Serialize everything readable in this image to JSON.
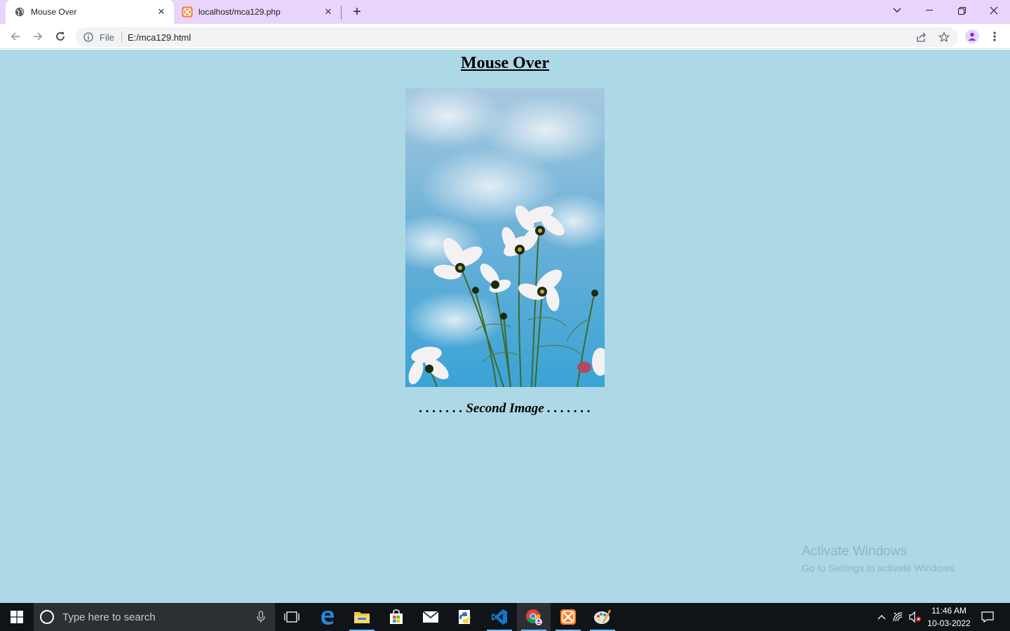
{
  "browser": {
    "tabs": [
      {
        "title": "Mouse Over",
        "active": true,
        "icon": "globe-icon"
      },
      {
        "title": "localhost/mca129.php",
        "active": false,
        "icon": "xampp-icon"
      }
    ],
    "address": {
      "scheme_label": "File",
      "url": "E:/mca129.html"
    }
  },
  "page": {
    "heading": "Mouse Over",
    "caption": ". . . . . . . Second Image . . . . . . .",
    "image": {
      "subject": "white cosmos flowers against blue sky"
    }
  },
  "watermark": {
    "line1": "Activate Windows",
    "line2": "Go to Settings to activate Windows."
  },
  "taskbar": {
    "search_placeholder": "Type here to search",
    "apps": [
      "task-view-icon",
      "edge-icon",
      "file-explorer-icon",
      "store-icon",
      "mail-icon",
      "python-icon",
      "vscode-icon",
      "chrome-icon",
      "xampp-icon",
      "paint-icon"
    ],
    "time": "11:46 AM",
    "date": "10-03-2022"
  },
  "colors": {
    "page_bg": "#add8e6",
    "tabstrip_bg": "#e9d4fb",
    "taskbar_bg": "#101418"
  }
}
